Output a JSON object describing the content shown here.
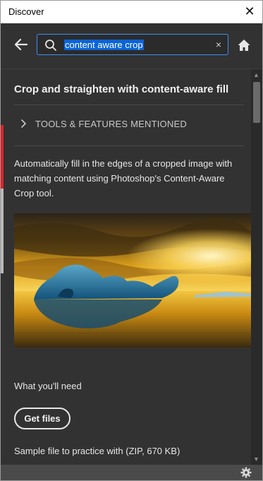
{
  "window": {
    "title": "Discover",
    "close_icon": "close-icon"
  },
  "header": {
    "back_icon": "arrow-left-icon",
    "search": {
      "value": "content aware crop",
      "icon": "search-icon",
      "clear_glyph": "×"
    },
    "home_icon": "home-icon"
  },
  "article": {
    "title": "Crop and straighten with content-aware fill",
    "tools_section": {
      "label": "TOOLS & FEATURES MENTIONED",
      "icon": "chevron-right-icon",
      "expanded": false
    },
    "description": "Automatically fill in the edges of a cropped image with matching content using Photoshop's Content-Aware Crop tool.",
    "hero_image": "iceberg-sunset-image",
    "need_label": "What you'll need",
    "get_files_label": "Get files",
    "sample_file_text": "Sample file to practice with (ZIP, 670 KB)"
  },
  "footer": {
    "settings_icon": "gear-icon"
  },
  "colors": {
    "panel_bg": "#323232",
    "search_border": "#3f8ef3",
    "selection": "#0a64d6",
    "footer_bg": "#4a4a4a"
  }
}
